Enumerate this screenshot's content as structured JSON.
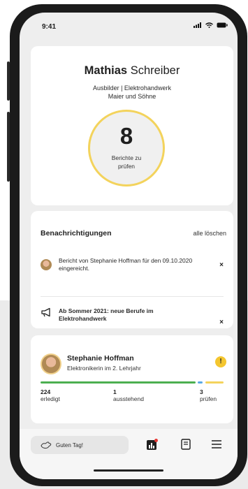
{
  "status_bar": {
    "time": "9:41"
  },
  "profile": {
    "first_name": "Mathias",
    "last_name": "Schreiber",
    "role": "Ausbilder | Elektrohandwerk",
    "company": "Maier und Söhne",
    "reports_to_review": "8",
    "reports_label": "Berichte zu prüfen"
  },
  "notifications": {
    "title": "Benachrichtigungen",
    "clear_all": "alle löschen",
    "items": [
      {
        "text": "Bericht von Stephanie Hoffman für den 09.10.2020 eingereicht.",
        "icon": "user-avatar",
        "close": "×"
      },
      {
        "text": "Ab Sommer 2021: neue Berufe im Elektrohandwerk",
        "icon": "megaphone-icon",
        "close": "×"
      }
    ]
  },
  "trainee": {
    "name": "Stephanie Hoffman",
    "description": "Elektronikerin im 2. Lehrjahr",
    "alert": "!",
    "stats": [
      {
        "value": "224",
        "label": "erledigt"
      },
      {
        "value": "1",
        "label": "ausstehend"
      },
      {
        "value": "3",
        "label": "prüfen"
      }
    ],
    "progress_colors": {
      "done": "#4caf50",
      "pending": "#5aa9e6",
      "review": "#f4d35c"
    }
  },
  "tabbar": {
    "greeting": "Guten Tag!",
    "icons": [
      "chart-icon",
      "book-icon",
      "menu-icon"
    ]
  },
  "colors": {
    "accent": "#f3d35c",
    "warning": "#f4c62f"
  }
}
